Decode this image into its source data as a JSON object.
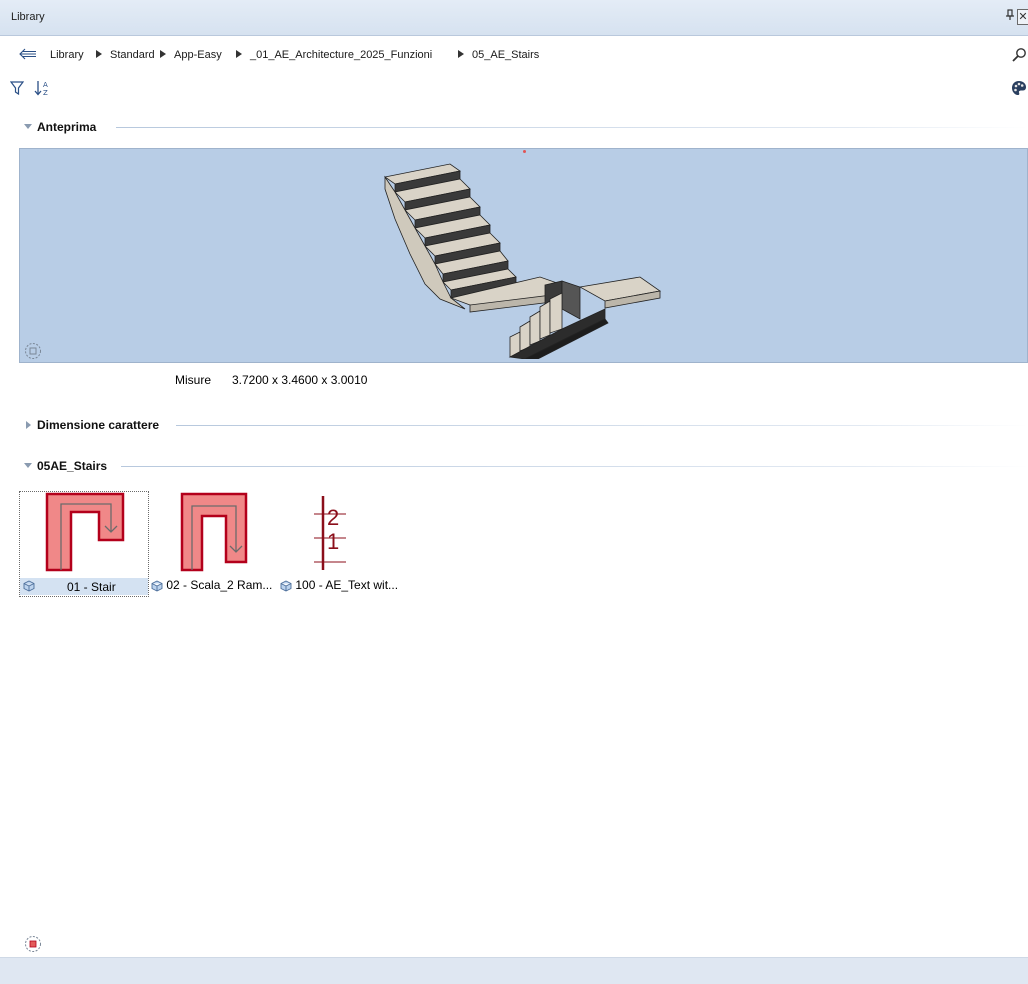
{
  "window": {
    "title": "Library",
    "pin_glyph": "‡",
    "close_glyph": "✕"
  },
  "breadcrumb": {
    "back_icon": "back-arrow-icon",
    "items": [
      "Library",
      "Standard",
      "App-Easy",
      "_01_AE_Architecture_2025_Funzioni",
      "05_AE_Stairs"
    ],
    "search_icon": "search-icon"
  },
  "toolbar": {
    "filter_icon": "filter-icon",
    "sort_icon": "sort-az-icon",
    "palette_icon": "palette-icon"
  },
  "sections": {
    "preview": {
      "title": "Anteprima",
      "expanded": true
    },
    "font_size": {
      "title": "Dimensione carattere",
      "expanded": false
    },
    "folder": {
      "title": "05AE_Stairs",
      "expanded": true
    }
  },
  "preview": {
    "background": "#b8cde6",
    "measure_label": "Misure",
    "measure_value": "3.7200 x 3.4600 x 3.0010"
  },
  "items": [
    {
      "name": "01 - Stair",
      "selected": true,
      "thumb": "u-stair-plan"
    },
    {
      "name": "02 - Scala_2 Ram...",
      "selected": false,
      "thumb": "double-ramp-plan"
    },
    {
      "name": "100 - AE_Text wit...",
      "selected": false,
      "thumb": "level-text",
      "levels": [
        "2",
        "1"
      ]
    }
  ],
  "colors": {
    "thumb_fill": "#f08888",
    "thumb_stroke": "#b3001b",
    "level_color": "#8b0e1a",
    "selection": "#d4e2f2"
  }
}
